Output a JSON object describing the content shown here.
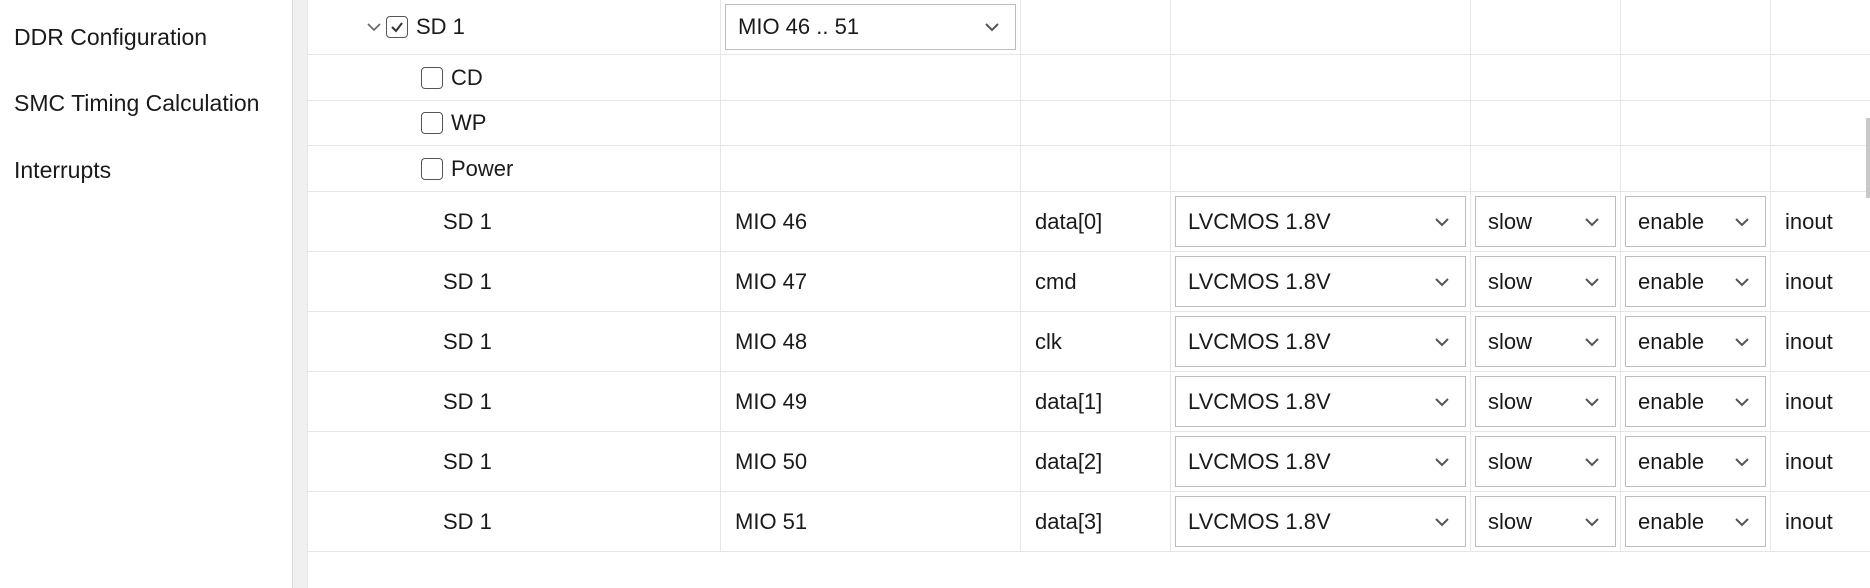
{
  "sidebar": {
    "items": [
      {
        "label": "DDR Configuration"
      },
      {
        "label": "SMC Timing Calculation"
      },
      {
        "label": "Interrupts"
      }
    ]
  },
  "sd_group": {
    "label": "SD 1",
    "checked": true,
    "mio_range": "MIO 46 .. 51",
    "options": [
      {
        "label": "CD",
        "checked": false
      },
      {
        "label": "WP",
        "checked": false
      },
      {
        "label": "Power",
        "checked": false
      }
    ]
  },
  "pins": [
    {
      "peripheral": "SD 1",
      "mio": "MIO 46",
      "signal": "data[0]",
      "io_type": "LVCMOS 1.8V",
      "speed": "slow",
      "pullup": "enable",
      "direction": "inout"
    },
    {
      "peripheral": "SD 1",
      "mio": "MIO 47",
      "signal": "cmd",
      "io_type": "LVCMOS 1.8V",
      "speed": "slow",
      "pullup": "enable",
      "direction": "inout"
    },
    {
      "peripheral": "SD 1",
      "mio": "MIO 48",
      "signal": "clk",
      "io_type": "LVCMOS 1.8V",
      "speed": "slow",
      "pullup": "enable",
      "direction": "inout"
    },
    {
      "peripheral": "SD 1",
      "mio": "MIO 49",
      "signal": "data[1]",
      "io_type": "LVCMOS 1.8V",
      "speed": "slow",
      "pullup": "enable",
      "direction": "inout"
    },
    {
      "peripheral": "SD 1",
      "mio": "MIO 50",
      "signal": "data[2]",
      "io_type": "LVCMOS 1.8V",
      "speed": "slow",
      "pullup": "enable",
      "direction": "inout"
    },
    {
      "peripheral": "SD 1",
      "mio": "MIO 51",
      "signal": "data[3]",
      "io_type": "LVCMOS 1.8V",
      "speed": "slow",
      "pullup": "enable",
      "direction": "inout"
    }
  ],
  "icons": {
    "expand": "chevron-down-icon",
    "checkbox_checked": "checkmark-icon",
    "dropdown": "chevron-down-icon"
  }
}
